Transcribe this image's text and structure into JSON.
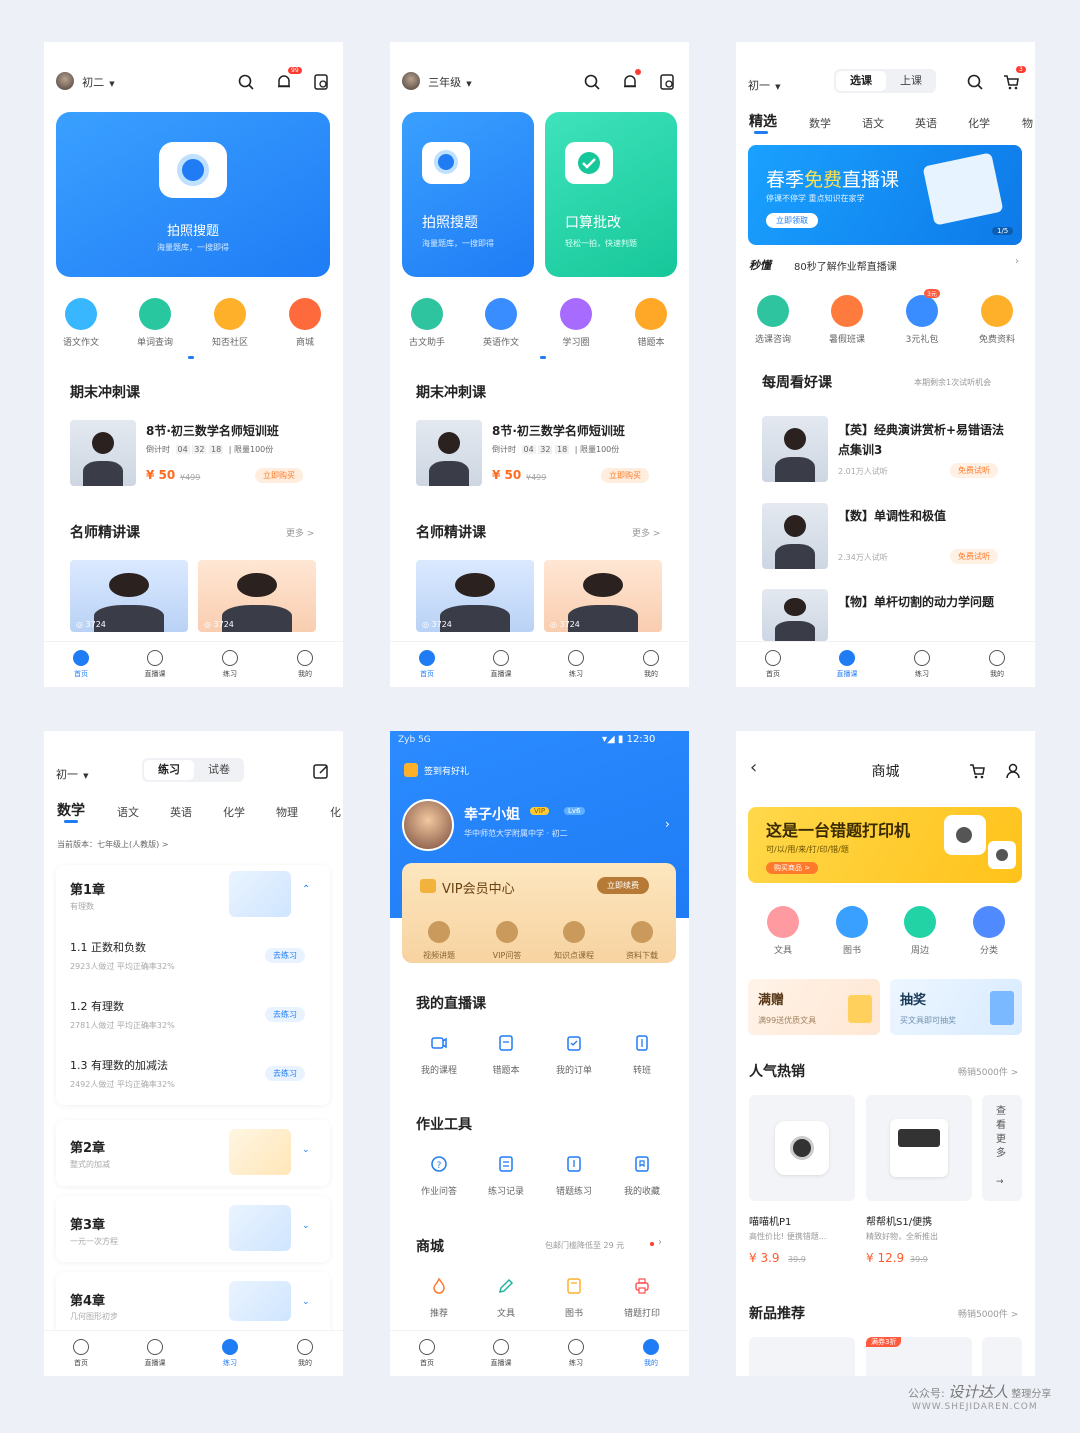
{
  "colors": {
    "primary": "#1f7cf5",
    "green": "#22d3a6",
    "orange": "#ff6a1f",
    "bg": "#eef0f7"
  },
  "common": {
    "tabs": [
      "首页",
      "直播课",
      "练习",
      "我的"
    ]
  },
  "p1": {
    "grade": "初二",
    "notif_badge": "99",
    "hero_title": "拍照搜题",
    "hero_sub": "海量题库，一搜即得",
    "icons": [
      "语文作文",
      "单词查询",
      "知否社区",
      "商城"
    ],
    "sprint_title": "期末冲刺课",
    "course_title": "8节·初三数学名师短训班",
    "countdown_label": "倒计时",
    "countdown": [
      "04",
      "32",
      "18"
    ],
    "limit": "| 限量100份",
    "price": "¥ 50",
    "old_price": "¥499",
    "buy": "立即购买",
    "teacher_title": "名师精讲课",
    "more": "更多 >",
    "views1": "◎ 3724",
    "views2": "◎ 3724"
  },
  "p2": {
    "grade": "三年级",
    "hero1_title": "拍照搜题",
    "hero1_sub": "海量题库，一搜即得",
    "hero2_title": "口算批改",
    "hero2_sub": "轻松一拍，快速判题",
    "icons": [
      "古文助手",
      "英语作文",
      "学习圈",
      "错题本"
    ],
    "sprint_title": "期末冲刺课",
    "course_title": "8节·初三数学名师短训班",
    "countdown_label": "倒计时",
    "countdown": [
      "04",
      "32",
      "18"
    ],
    "limit": "| 限量100份",
    "price": "¥ 50",
    "old_price": "¥499",
    "buy": "立即购买",
    "teacher_title": "名师精讲课",
    "more": "更多 >",
    "views1": "◎ 3724",
    "views2": "◎ 3724"
  },
  "p3": {
    "grade": "初一",
    "seg": [
      "选课",
      "上课"
    ],
    "cart_badge": "3",
    "subjects": [
      "精选",
      "数学",
      "语文",
      "英语",
      "化学",
      "物"
    ],
    "banner_title_a": "春季",
    "banner_title_b": "免费",
    "banner_title_c": "直播课",
    "banner_sub": "停课不停学 重点知识在家学",
    "banner_btn": "立即领取",
    "banner_page": "1/5",
    "news_tag": "秒懂",
    "news_text": "80秒了解作业帮直播课",
    "icons": [
      "选课咨询",
      "暑假班课",
      "3元礼包",
      "免费资料"
    ],
    "gift_badge": "3元",
    "weekly_title": "每周看好课",
    "weekly_note": "本期剩余1次试听机会",
    "courses": [
      {
        "title": "【英】经典演讲赏析+易错语法点集训3",
        "meta": "2.01万人试听",
        "btn": "免费试听"
      },
      {
        "title": "【数】单调性和极值",
        "meta": "2.34万人试听",
        "btn": "免费试听"
      },
      {
        "title": "【物】单杆切割的动力学问题",
        "meta": "",
        "btn": ""
      }
    ]
  },
  "p4": {
    "grade": "初一",
    "seg": [
      "练习",
      "试卷"
    ],
    "subjects": [
      "数学",
      "语文",
      "英语",
      "化学",
      "物理",
      "化"
    ],
    "edition": "当前版本：七年级上(人教版) >",
    "ch1_title": "第1章",
    "ch1_sub": "有理数",
    "lessons": [
      {
        "title": "1.1 正数和负数",
        "meta": "2923人做过    平均正确率32%",
        "btn": "去练习"
      },
      {
        "title": "1.2 有理数",
        "meta": "2781人做过    平均正确率32%",
        "btn": "去练习"
      },
      {
        "title": "1.3 有理数的加减法",
        "meta": "2492人做过    平均正确率32%",
        "btn": "去练习"
      }
    ],
    "chapters": [
      {
        "title": "第2章",
        "sub": "整式的加减"
      },
      {
        "title": "第3章",
        "sub": "一元一次方程"
      },
      {
        "title": "第4章",
        "sub": "几何图形初步"
      }
    ]
  },
  "p5": {
    "carrier": "Zyb 5G",
    "time": "12:30",
    "signin": "签到有好礼",
    "name": "幸子小姐",
    "level": "Lv6",
    "vip_badge": "VIP",
    "school": "华中师范大学附属中学 · 初二",
    "vip_title": "VIP会员中心",
    "vip_btn": "立即续费",
    "vip_items": [
      "视频讲题",
      "VIP问答",
      "知识点课程",
      "资料下载"
    ],
    "live_title": "我的直播课",
    "live_items": [
      "我的课程",
      "错题本",
      "我的订单",
      "转班"
    ],
    "tool_title": "作业工具",
    "tool_items": [
      "作业问答",
      "练习记录",
      "错题练习",
      "我的收藏"
    ],
    "mall_title": "商城",
    "mall_note": "包邮门槛降低至 29 元",
    "mall_items": [
      "推荐",
      "文具",
      "图书",
      "错题打印"
    ]
  },
  "p6": {
    "title": "商城",
    "banner_title": "这是一台错题打印机",
    "banner_sub": "可/以/用/来/打/印/错/题",
    "banner_btn": "购买商品 >",
    "cats": [
      "文具",
      "图书",
      "周边",
      "分类"
    ],
    "promo1_title": "满赠",
    "promo1_sub": "满99送优质文具",
    "promo2_title": "抽奖",
    "promo2_sub": "买文具即可抽奖",
    "hot_title": "人气热销",
    "hot_note": "畅销5000件 >",
    "see_more": "查看更多",
    "products": [
      {
        "name": "喵喵机P1",
        "desc": "高性价比! 便携错题...",
        "price": "¥ 3.9",
        "old": "39.9"
      },
      {
        "name": "帮帮机S1/便携",
        "desc": "精致好物，全新推出",
        "price": "¥ 12.9",
        "old": "39.9"
      }
    ],
    "new_title": "新品推荐",
    "new_note": "畅销5000件 >",
    "new_badge": "满券3折"
  },
  "watermark": {
    "line1a": "公众号: ",
    "line1b": "设计达人",
    "line1c": " 整理分享",
    "line2": "WWW.SHEJIDAREN.COM"
  }
}
